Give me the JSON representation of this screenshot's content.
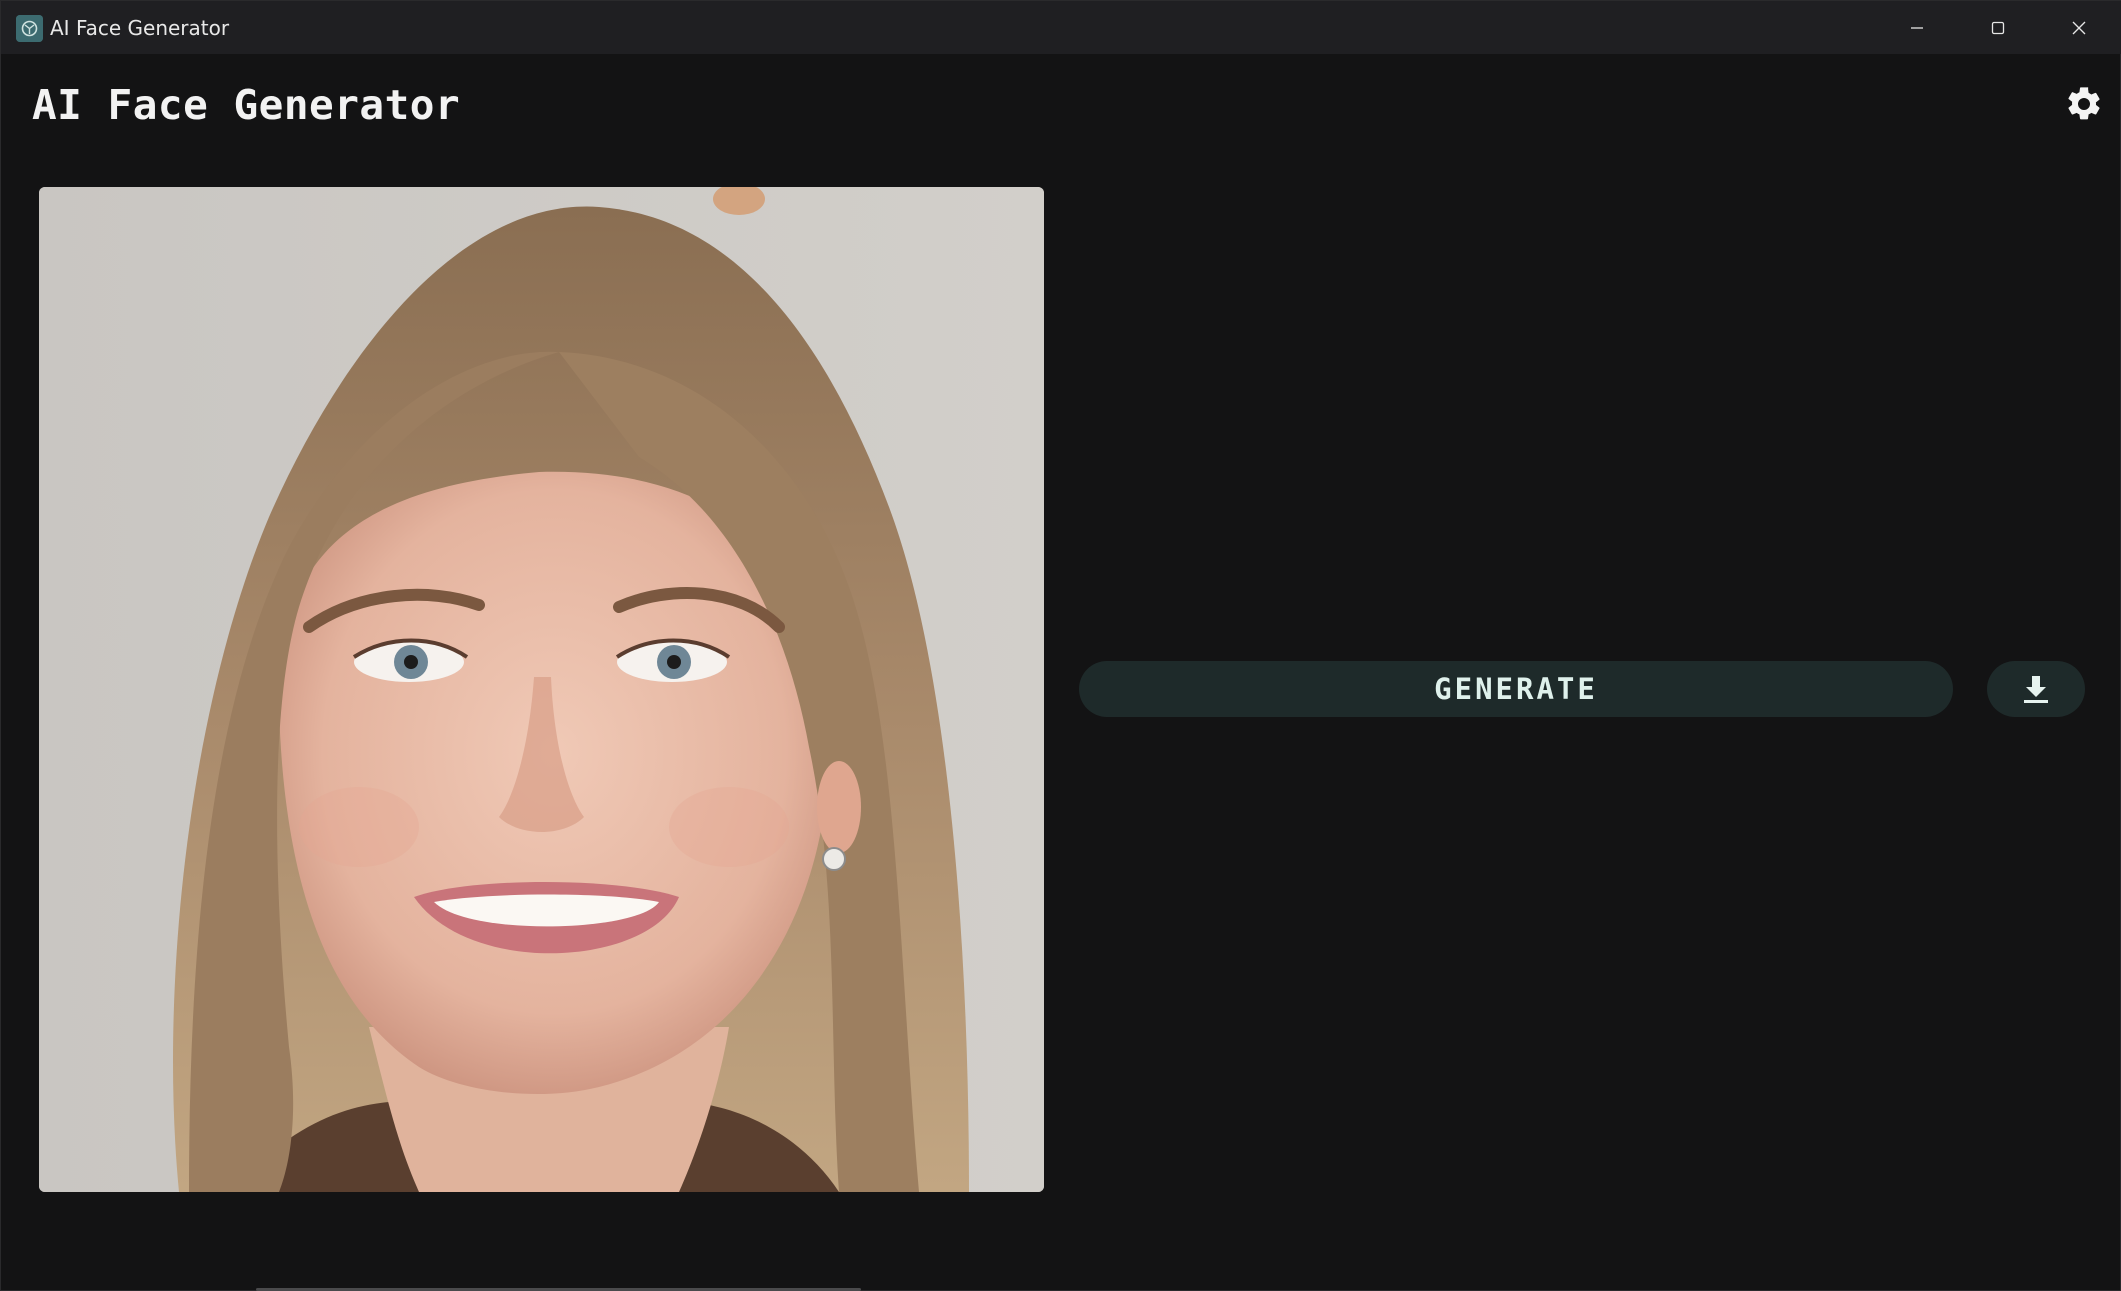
{
  "window": {
    "title": "AI Face Generator",
    "icon": "app-icon"
  },
  "controls": {
    "minimize_icon": "minimize-icon",
    "maximize_icon": "maximize-icon",
    "close_icon": "close-icon"
  },
  "app": {
    "title": "AI Face Generator",
    "settings_icon": "gear-icon"
  },
  "image": {
    "subject": "generated portrait"
  },
  "actions": {
    "generate_label": "GENERATE",
    "download_icon": "download-icon"
  },
  "colors": {
    "background": "#131314",
    "titlebar": "#1f1f22",
    "button_bg": "#1e2a2a",
    "button_text": "#dff1ec"
  }
}
